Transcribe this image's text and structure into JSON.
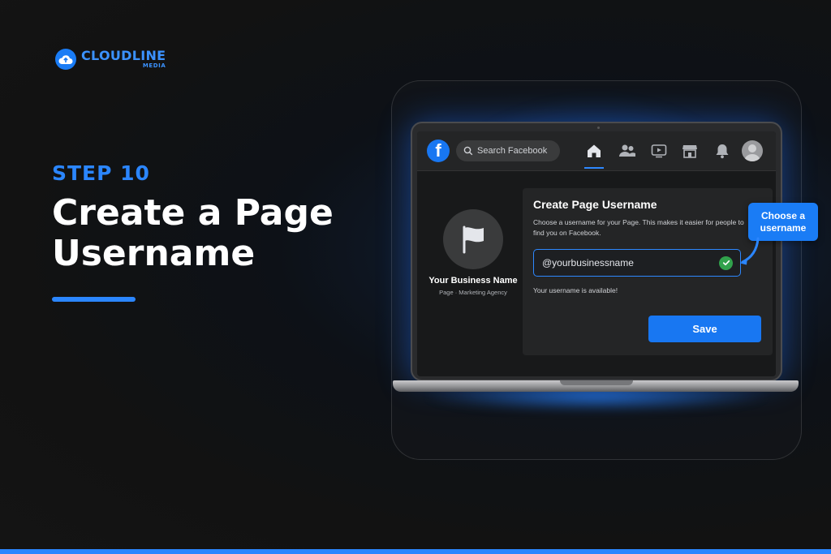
{
  "brand": {
    "name": "CLOUDLINE",
    "sub": "MEDIA",
    "color": "#2b86ff"
  },
  "headline": {
    "step": "STEP 10",
    "title": "Create a Page Username"
  },
  "facebook": {
    "search_placeholder": "Search Facebook",
    "nav_icons": [
      "home-icon",
      "friends-icon",
      "watch-icon",
      "marketplace-icon",
      "bell-icon"
    ],
    "page": {
      "name": "Your Business Name",
      "subtitle": "Page · Marketing Agency"
    },
    "card": {
      "title": "Create Page Username",
      "description": "Choose a username for your Page. This makes it easier for people to find you on Facebook.",
      "username_value": "@yourbusinessname",
      "status": "Your username is available!",
      "save_label": "Save"
    }
  },
  "callout": {
    "text": "Choose a username"
  },
  "colors": {
    "accent": "#2b86ff",
    "fb_blue": "#1877f2",
    "success": "#31a24c",
    "background": "#121212"
  }
}
